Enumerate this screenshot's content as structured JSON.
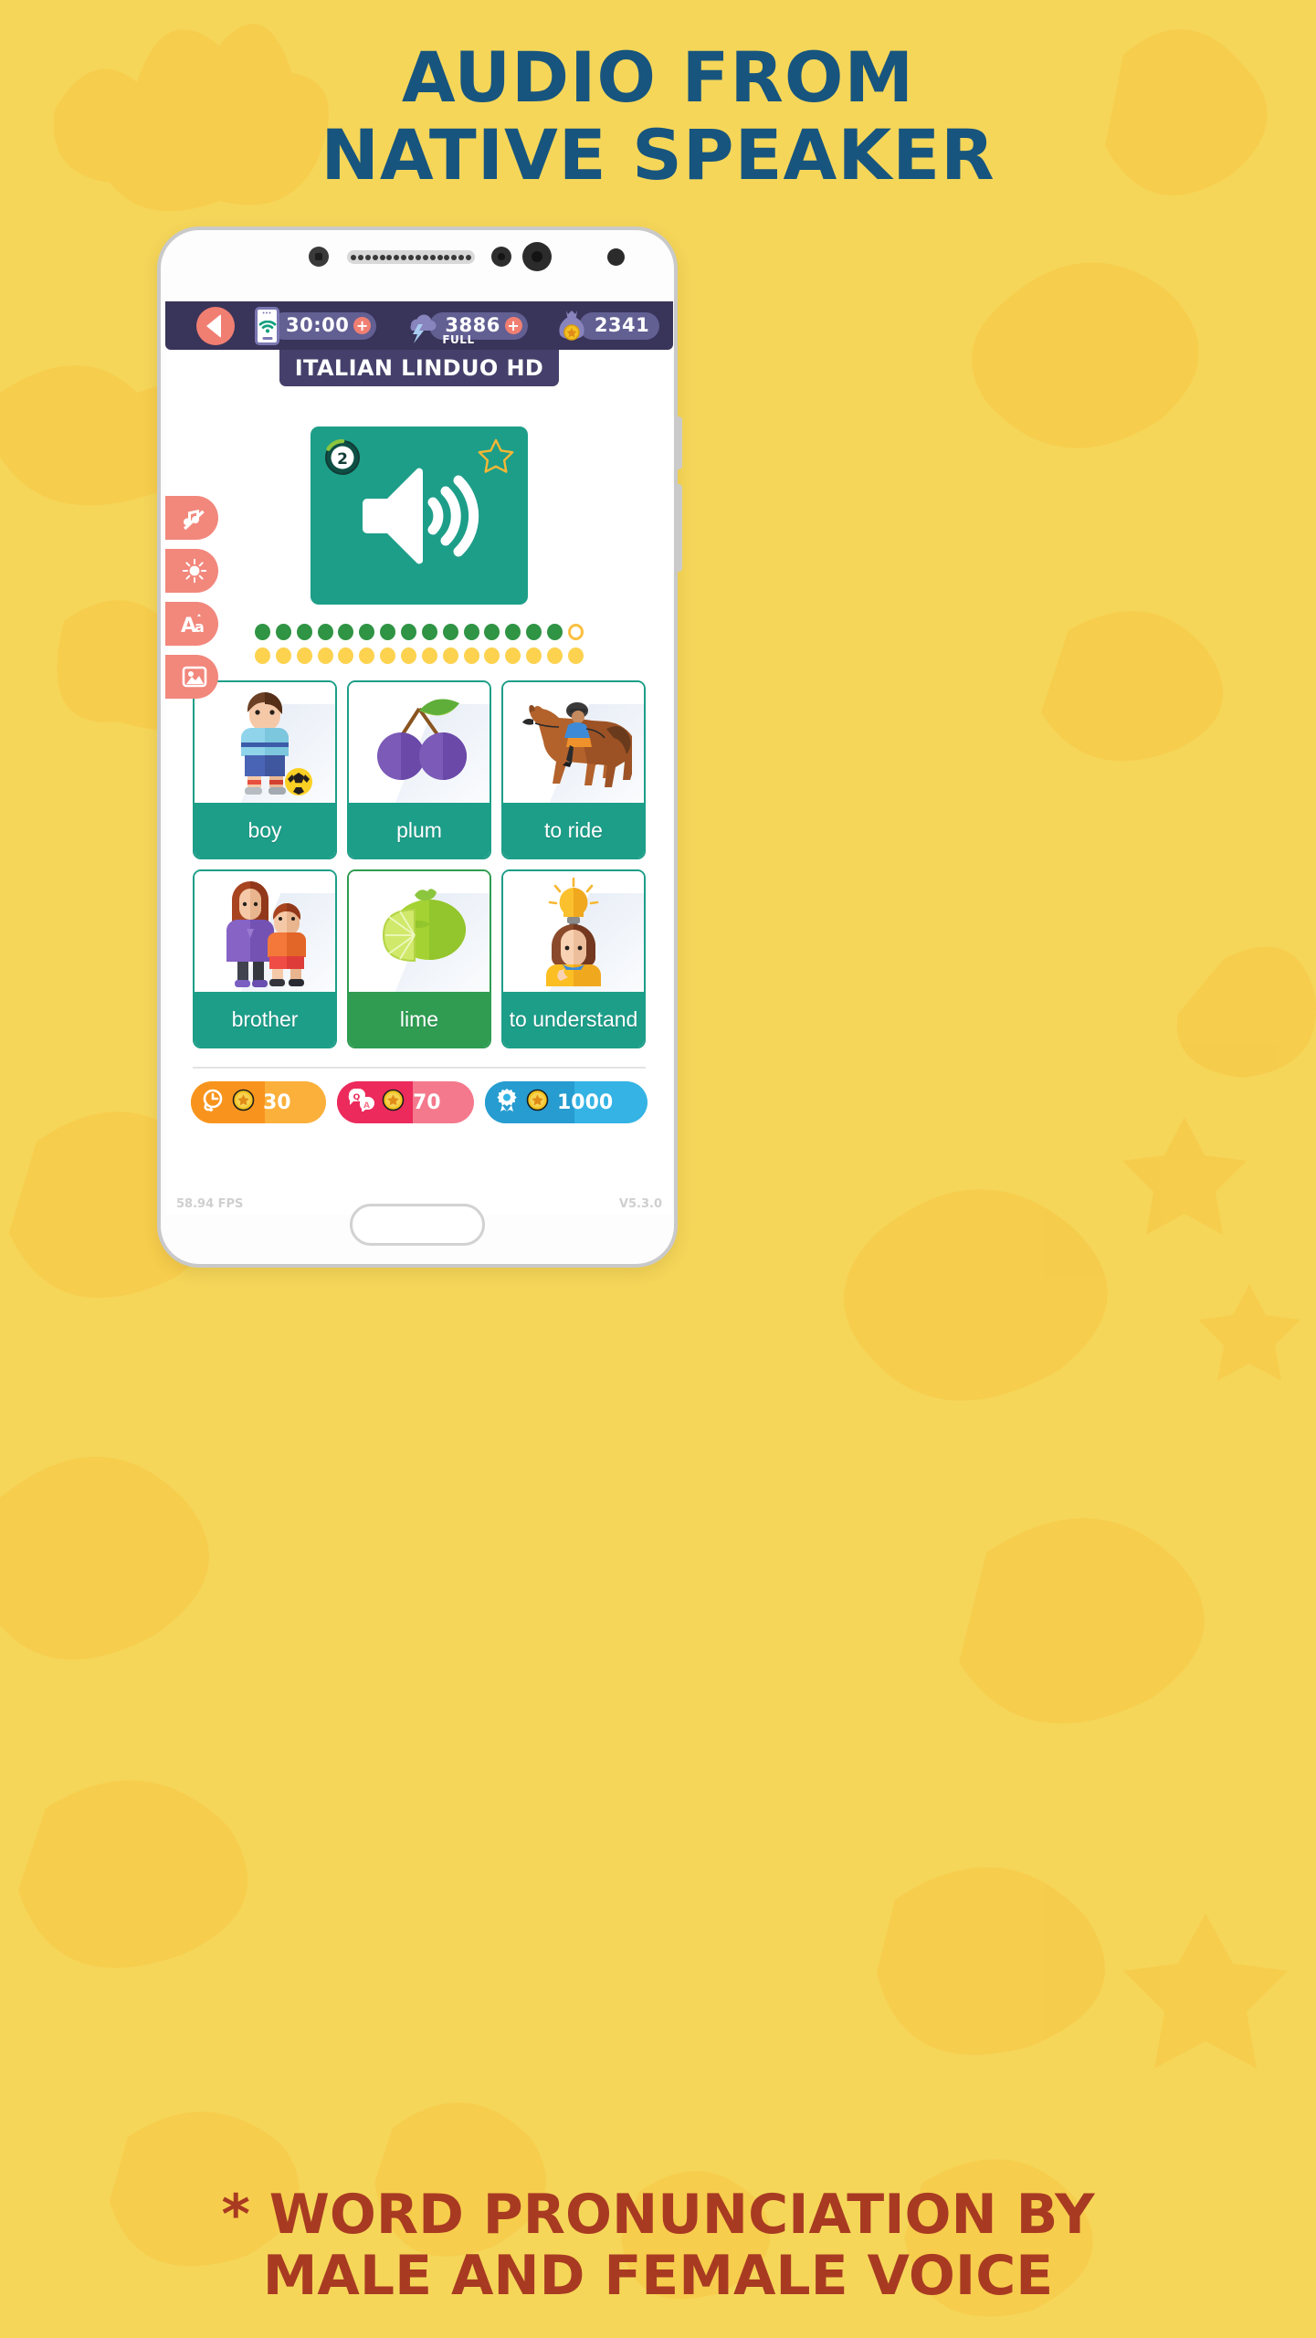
{
  "promo": {
    "headline_line1": "AUDIO FROM",
    "headline_line2": "NATIVE SPEAKER",
    "footer_line1": "* WORD PRONUNCIATION BY",
    "footer_line2": "MALE AND FEMALE VOICE",
    "headline_color": "#17557f",
    "footer_color": "#a83a22",
    "background_color": "#f5d659"
  },
  "app": {
    "title": "ITALIAN LINDUO HD",
    "hud": {
      "back_icon": "back-arrow-icon",
      "timer": {
        "icon": "wifi-phone-icon",
        "value": "30:00",
        "plus": "+"
      },
      "energy": {
        "icon": "storm-cloud-icon",
        "value": "3886",
        "plus": "+",
        "tag": "FULL"
      },
      "coins": {
        "icon": "money-bag-icon",
        "value": "2341"
      }
    },
    "tools": [
      {
        "name": "music-off-icon",
        "label": "Music off"
      },
      {
        "name": "brightness-icon",
        "label": "Brightness"
      },
      {
        "name": "font-size-icon",
        "label": "Font"
      },
      {
        "name": "image-icon",
        "label": "Images"
      }
    ],
    "speaker_card": {
      "level_badge": "2",
      "star_icon": "star-outline-icon",
      "speaker_icon": "speaker-volume-icon",
      "bg_color": "#1d9e89"
    },
    "progress": {
      "row_green_total": 16,
      "row_green_filled": 15,
      "row_yellow_total": 16,
      "row_yellow_filled": 16,
      "green_color": "#2f9444",
      "yellow_color": "#fcd24f"
    },
    "word_cards": [
      {
        "label": "boy",
        "art": "boy-with-ball",
        "label_color": "#1d9e89"
      },
      {
        "label": "plum",
        "art": "plums",
        "label_color": "#1d9e89"
      },
      {
        "label": "to ride",
        "art": "horse-rider",
        "label_color": "#1d9e89"
      },
      {
        "label": "brother",
        "art": "mother-and-boy",
        "label_color": "#1d9e89"
      },
      {
        "label": "lime",
        "art": "lime-fruit",
        "label_color": "#2f9c52"
      },
      {
        "label": "to understand",
        "art": "girl-with-idea",
        "label_color": "#1d9e89"
      }
    ],
    "stats": [
      {
        "icon": "clock-icon",
        "coin": "coin-icon",
        "value": "30",
        "color": "#fbb03b"
      },
      {
        "icon": "qa-bubbles-icon",
        "coin": "coin-icon",
        "value": "70",
        "color": "#f4798c"
      },
      {
        "icon": "medal-icon",
        "coin": "coin-icon",
        "value": "1000",
        "color": "#34b3e4"
      }
    ],
    "footer": {
      "fps": "58.94 FPS",
      "version": "V5.3.0"
    }
  }
}
